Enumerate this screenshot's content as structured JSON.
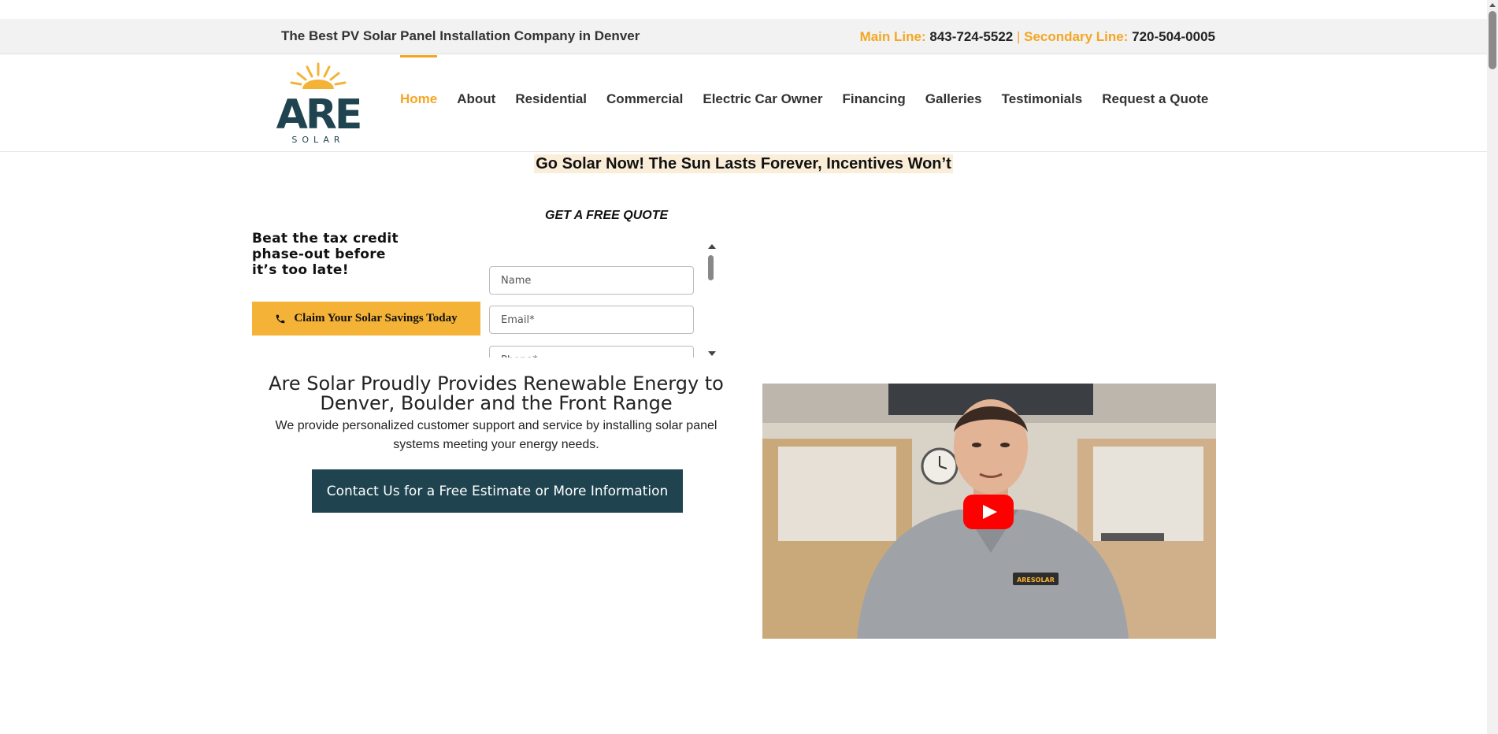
{
  "topbar": {
    "tagline": "The Best PV Solar Panel Installation Company in Denver",
    "main_label": "Main Line:",
    "main_number": "843-724-5522",
    "separator": "|",
    "secondary_label": "Secondary Line:",
    "secondary_number": "720-504-0005"
  },
  "logo": {
    "name": "ARE",
    "subtitle": "SOLAR"
  },
  "nav": {
    "items": [
      {
        "label": "Home"
      },
      {
        "label": "About"
      },
      {
        "label": "Residential"
      },
      {
        "label": "Commercial"
      },
      {
        "label": "Electric Car Owner"
      },
      {
        "label": "Financing"
      },
      {
        "label": "Galleries"
      },
      {
        "label": "Testimonials"
      },
      {
        "label": "Request a Quote"
      }
    ]
  },
  "promo": {
    "text": "Go Solar Now! The Sun Lasts Forever, Incentives Won’t"
  },
  "quote": {
    "title": "GET A FREE QUOTE",
    "beat_text": "Beat the tax credit phase-out before it’s too late!",
    "claim_label": "Claim Your Solar Savings Today",
    "fields": [
      {
        "placeholder": "Name"
      },
      {
        "placeholder": "Email*"
      },
      {
        "placeholder": "Phone*"
      }
    ]
  },
  "main": {
    "heading": "Are Solar Proudly Provides Renewable Energy to Denver, Boulder and the Front Range",
    "description": "We provide personalized customer support and service by installing solar panel systems meeting your energy needs.",
    "contact_label": "Contact Us for a Free Estimate or More Information"
  },
  "video": {
    "shirt_logo": "ARESOLAR"
  },
  "colors": {
    "accent": "#f4a623",
    "button_dark": "#1f4450",
    "play": "#ff0000"
  }
}
